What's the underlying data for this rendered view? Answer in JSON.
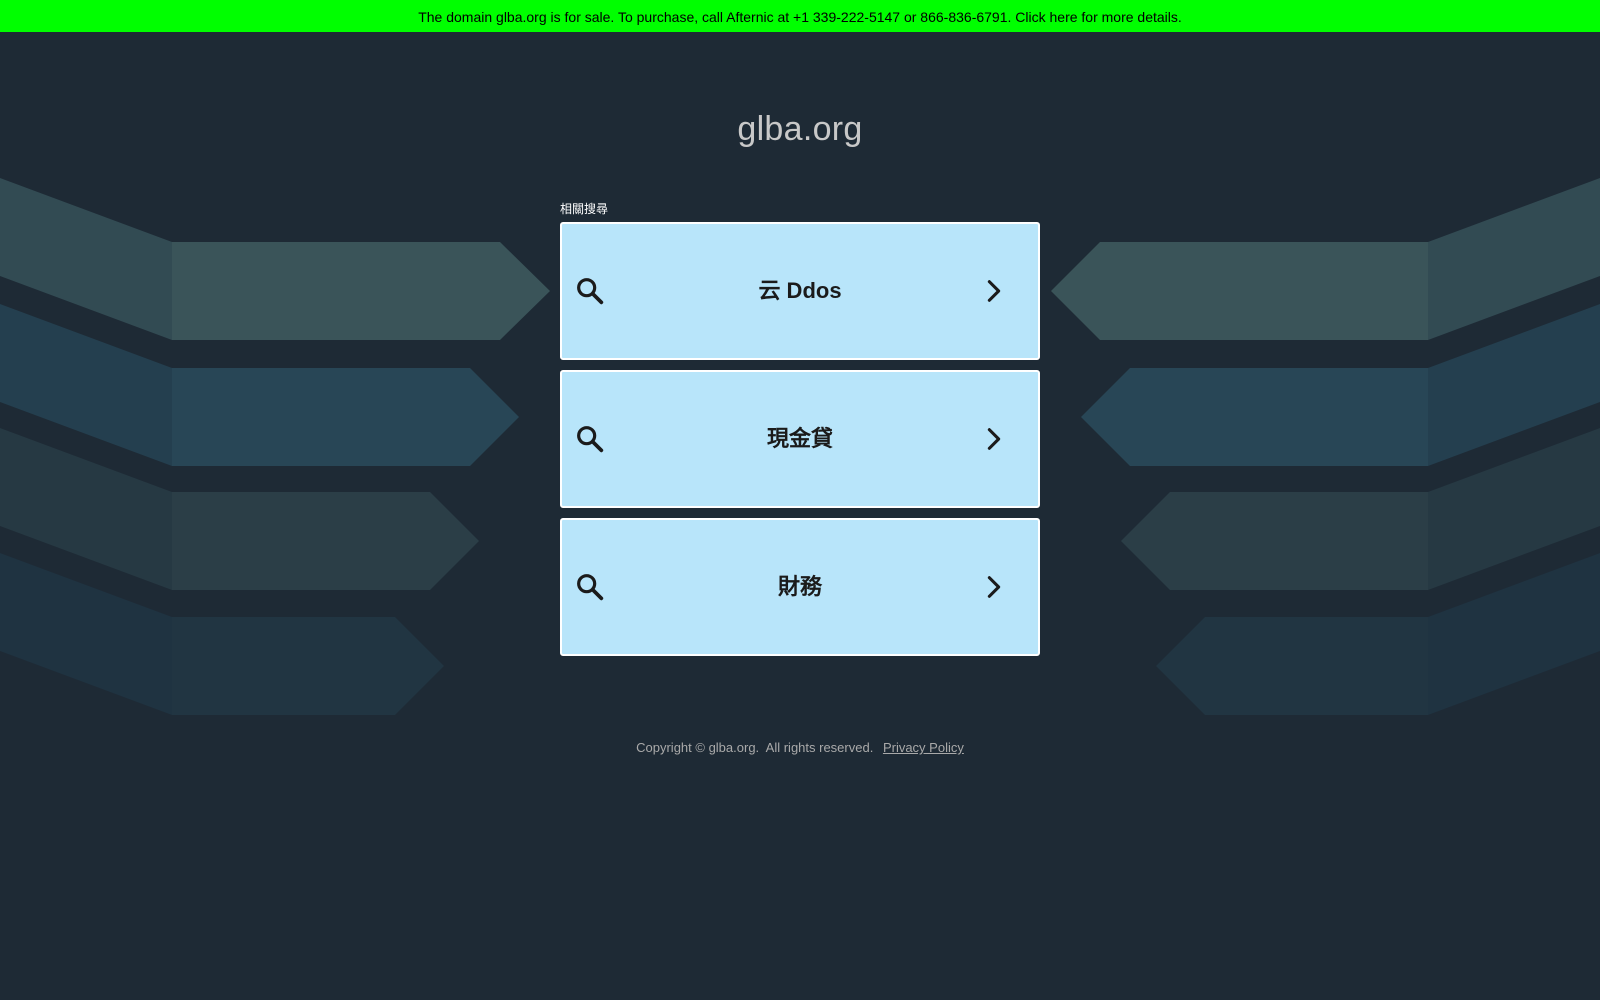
{
  "banner": {
    "text": "The domain glba.org is for sale. To purchase, call Afternic at +1 339-222-5147 or 866-836-6791. Click here for more details.",
    "color": "#00ff00"
  },
  "page": {
    "domain_title": "glba.org",
    "related_label": "相關搜尋",
    "background_color": "#1e2a35"
  },
  "searches": [
    {
      "label": "云 Ddos",
      "icon": "search-icon",
      "arrow_icon": "chevron-right-icon"
    },
    {
      "label": "現金貸",
      "icon": "search-icon",
      "arrow_icon": "chevron-right-icon"
    },
    {
      "label": "財務",
      "icon": "search-icon",
      "arrow_icon": "chevron-right-icon"
    }
  ],
  "footer": {
    "copyright": "Copyright © glba.org.  All rights reserved.",
    "privacy_label": "Privacy Policy"
  }
}
